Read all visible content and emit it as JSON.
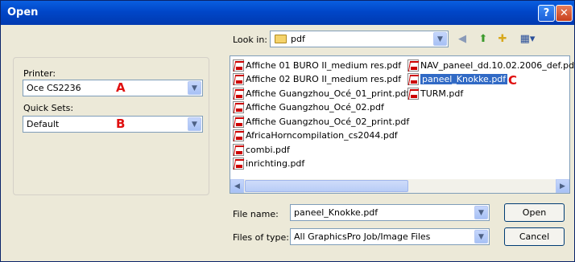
{
  "dialog": {
    "title": "Open",
    "help_glyph": "?",
    "close_glyph": "✕"
  },
  "left": {
    "printer_label": "Printer:",
    "printer_value": "Oce CS2236",
    "printer_marker": "A",
    "quicksets_label": "Quick Sets:",
    "quicksets_value": "Default",
    "quicksets_marker": "B"
  },
  "toolbar": {
    "lookin_label": "Look in:",
    "lookin_value": "pdf"
  },
  "files": {
    "column1": [
      "Affiche 01 BURO II_medium res.pdf",
      "Affiche 02 BURO II_medium res.pdf",
      "Affiche Guangzhou_Océ_01_print.pdf",
      "Affiche Guangzhou_Océ_02.pdf",
      "Affiche Guangzhou_Océ_02_print.pdf",
      "AfricaHorncompilation_cs2044.pdf",
      "combi.pdf",
      "inrichting.pdf"
    ],
    "column2": [
      "NAV_paneel_dd.10.02.2006_def.pdf",
      "paneel_Knokke.pdf",
      "TURM.pdf"
    ],
    "selected_marker": "C"
  },
  "bottom": {
    "filename_label": "File name:",
    "filename_value": "paneel_Knokke.pdf",
    "filetype_label": "Files of type:",
    "filetype_value": "All GraphicsPro Job/Image Files",
    "open_label": "Open",
    "cancel_label": "Cancel"
  }
}
